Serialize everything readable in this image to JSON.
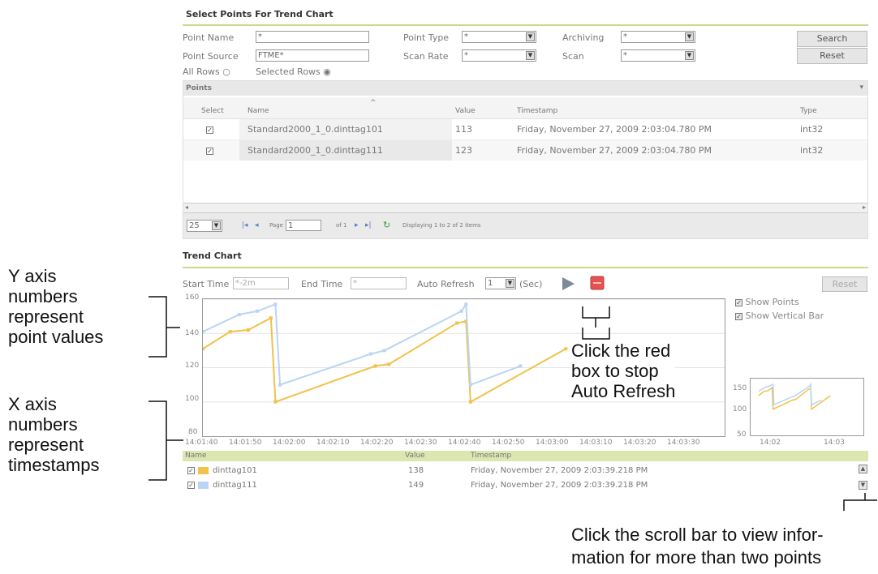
{
  "select_section": {
    "title": "Select Points For Trend Chart",
    "point_name_label": "Point Name",
    "point_name_value": "*",
    "point_source_label": "Point Source",
    "point_source_value": "FTME*",
    "point_type_label": "Point Type",
    "point_type_value": "*",
    "scan_rate_label": "Scan Rate",
    "scan_rate_value": "*",
    "archiving_label": "Archiving",
    "archiving_value": "*",
    "scan_label": "Scan",
    "scan_value": "*",
    "search_button": "Search",
    "reset_button": "Reset",
    "all_rows_label": "All Rows",
    "selected_rows_label": "Selected Rows"
  },
  "points_grid": {
    "title": "Points",
    "columns": [
      "Select",
      "Name",
      "Value",
      "Timestamp",
      "Type"
    ],
    "rows": [
      {
        "name": "Standard2000_1_0.dinttag101",
        "value": "113",
        "timestamp": "Friday, November 27, 2009 2:03:04.780 PM",
        "type": "int32"
      },
      {
        "name": "Standard2000_1_0.dinttag111",
        "value": "123",
        "timestamp": "Friday, November 27, 2009 2:03:04.780 PM",
        "type": "int32"
      }
    ],
    "pager": {
      "page_size": "25",
      "page_label": "Page",
      "page_value": "1",
      "of_label": "of 1",
      "status": "Displaying 1 to 2 of 2 items"
    }
  },
  "trend_section": {
    "title": "Trend Chart",
    "start_time_label": "Start Time",
    "start_time_value": "*-2m",
    "end_time_label": "End Time",
    "end_time_value": "*",
    "auto_refresh_label": "Auto Refresh",
    "auto_refresh_value": "1",
    "sec_label": "(Sec)",
    "reset_button": "Reset",
    "show_points_label": "Show Points",
    "show_vertical_bar_label": "Show Vertical Bar"
  },
  "chart_data": {
    "type": "line",
    "yticks": [
      "160",
      "140",
      "120",
      "100",
      "80"
    ],
    "xticks": [
      "14:01:40",
      "14:01:50",
      "14:02:00",
      "14:02:10",
      "14:02:20",
      "14:02:30",
      "14:02:40",
      "14:02:50",
      "14:03:00",
      "14:03:10",
      "14:03:20",
      "14:03:30"
    ],
    "ylim": [
      80,
      160
    ],
    "series": [
      {
        "name": "dinttag101",
        "color": "#f0c24a",
        "points": [
          [
            0,
            131
          ],
          [
            6,
            141
          ],
          [
            10,
            142
          ],
          [
            15,
            149
          ],
          [
            16,
            100
          ],
          [
            38,
            121
          ],
          [
            41,
            122
          ],
          [
            56,
            146
          ],
          [
            58,
            147
          ],
          [
            59,
            100
          ],
          [
            80,
            131
          ]
        ]
      },
      {
        "name": "dinttag111",
        "color": "#b9d4f4",
        "points": [
          [
            0,
            141
          ],
          [
            8,
            151
          ],
          [
            12,
            153
          ],
          [
            16,
            157
          ],
          [
            17,
            110
          ],
          [
            37,
            128
          ],
          [
            40,
            130
          ],
          [
            57,
            153
          ],
          [
            58,
            157
          ],
          [
            59,
            110
          ],
          [
            70,
            121
          ]
        ]
      }
    ],
    "overview_yticks": [
      "150",
      "100",
      "50"
    ],
    "overview_xticks": [
      "14:02",
      "14:03"
    ]
  },
  "legend_table": {
    "columns": [
      "Name",
      "Value",
      "Timestamp"
    ],
    "rows": [
      {
        "name": "dinttag101",
        "value": "138",
        "timestamp": "Friday, November 27, 2009 2:03:39.218 PM",
        "color": "#f0c24a"
      },
      {
        "name": "dinttag111",
        "value": "149",
        "timestamp": "Friday, November 27, 2009 2:03:39.218 PM",
        "color": "#b9d4f4"
      }
    ]
  },
  "annotations": {
    "y_axis": [
      "Y axis",
      "numbers",
      "represent",
      "point values"
    ],
    "x_axis": [
      "X axis",
      "numbers",
      "represent",
      "timestamps"
    ],
    "red_box": [
      "Click the red",
      "box to stop",
      "Auto Refresh"
    ],
    "scroll": [
      "Click the scroll bar to view infor-",
      "mation for more than two points"
    ]
  }
}
